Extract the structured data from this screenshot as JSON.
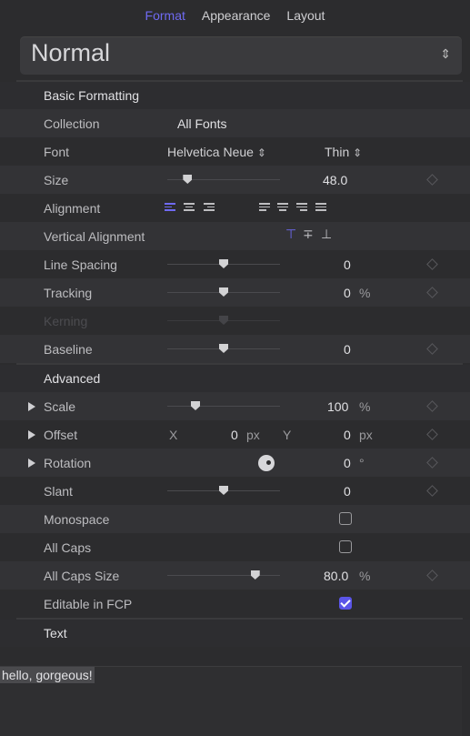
{
  "tabs": [
    {
      "label": "Format",
      "active": true
    },
    {
      "label": "Appearance",
      "active": false
    },
    {
      "label": "Layout",
      "active": false
    }
  ],
  "preset": {
    "name": "Normal",
    "icon": "up-down-chevron-icon"
  },
  "sections": {
    "basic": "Basic Formatting",
    "advanced": "Advanced",
    "text": "Text"
  },
  "rows": {
    "collection": {
      "label": "Collection",
      "value": "All Fonts"
    },
    "font": {
      "label": "Font",
      "family": "Helvetica Neue",
      "weight": "Thin"
    },
    "size": {
      "label": "Size",
      "value": "48.0",
      "slider_fraction": 0.18
    },
    "alignment": {
      "label": "Alignment",
      "selected": "left"
    },
    "vertical_alignment": {
      "label": "Vertical Alignment",
      "selected": "top"
    },
    "line_spacing": {
      "label": "Line Spacing",
      "value": "0",
      "slider_fraction": 0.5
    },
    "tracking": {
      "label": "Tracking",
      "value": "0",
      "unit": "%",
      "slider_fraction": 0.5
    },
    "kerning": {
      "label": "Kerning",
      "enabled": false
    },
    "baseline": {
      "label": "Baseline",
      "value": "0",
      "slider_fraction": 0.5
    },
    "scale": {
      "label": "Scale",
      "value": "100",
      "unit": "%",
      "slider_fraction": 0.25
    },
    "offset": {
      "label": "Offset",
      "x_label": "X",
      "x_value": "0",
      "x_unit": "px",
      "y_label": "Y",
      "y_value": "0",
      "y_unit": "px"
    },
    "rotation": {
      "label": "Rotation",
      "value": "0",
      "unit": "°"
    },
    "slant": {
      "label": "Slant",
      "value": "0",
      "slider_fraction": 0.5
    },
    "monospace": {
      "label": "Monospace",
      "checked": false
    },
    "all_caps": {
      "label": "All Caps",
      "checked": false
    },
    "all_caps_size": {
      "label": "All Caps Size",
      "value": "80.0",
      "unit": "%",
      "slider_fraction": 0.78
    },
    "editable_fcp": {
      "label": "Editable in FCP",
      "checked": true
    }
  },
  "text_content": "hello, gorgeous!",
  "colors": {
    "accent": "#6f6af2",
    "checkbox_on": "#5b55e8",
    "background": "#2c2c2e",
    "row_alt": "#333336"
  }
}
